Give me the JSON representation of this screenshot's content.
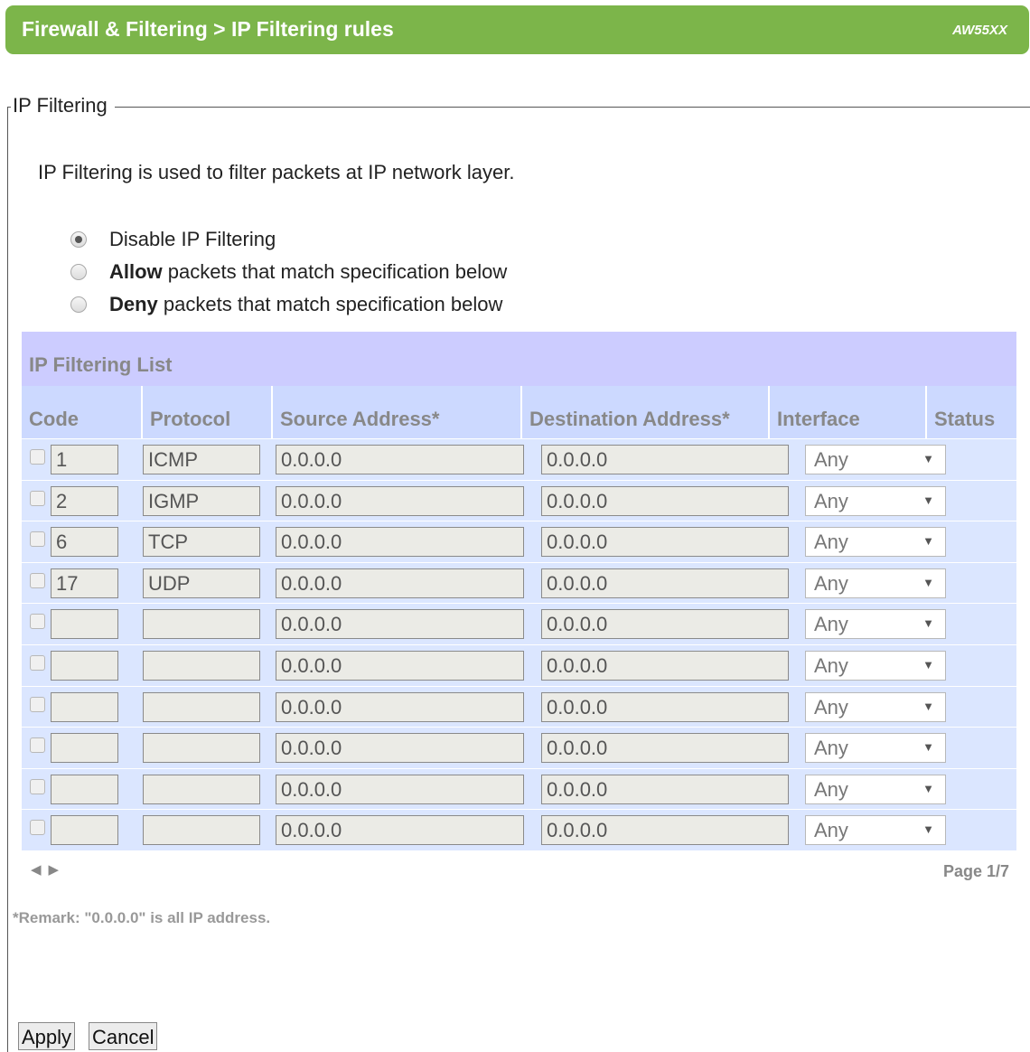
{
  "header": {
    "title": "Firewall & Filtering > IP Filtering rules",
    "model": "AW55XX"
  },
  "fieldset": {
    "legend": "IP Filtering",
    "description": "IP Filtering is used to filter packets at IP network layer."
  },
  "mode_options": [
    {
      "bold": "",
      "text": "Disable IP Filtering",
      "checked": true
    },
    {
      "bold": "Allow",
      "text": " packets that match specification below",
      "checked": false
    },
    {
      "bold": "Deny",
      "text": " packets that match specification below",
      "checked": false
    }
  ],
  "list": {
    "title": "IP Filtering List",
    "columns": [
      "Code",
      "Protocol",
      "Source Address*",
      "Destination Address*",
      "Interface",
      "Status"
    ],
    "rows": [
      {
        "code": "1",
        "protocol": "ICMP",
        "source": "0.0.0.0",
        "destination": "0.0.0.0",
        "interface": "Any"
      },
      {
        "code": "2",
        "protocol": "IGMP",
        "source": "0.0.0.0",
        "destination": "0.0.0.0",
        "interface": "Any"
      },
      {
        "code": "6",
        "protocol": "TCP",
        "source": "0.0.0.0",
        "destination": "0.0.0.0",
        "interface": "Any"
      },
      {
        "code": "17",
        "protocol": "UDP",
        "source": "0.0.0.0",
        "destination": "0.0.0.0",
        "interface": "Any"
      },
      {
        "code": "",
        "protocol": "",
        "source": "0.0.0.0",
        "destination": "0.0.0.0",
        "interface": "Any"
      },
      {
        "code": "",
        "protocol": "",
        "source": "0.0.0.0",
        "destination": "0.0.0.0",
        "interface": "Any"
      },
      {
        "code": "",
        "protocol": "",
        "source": "0.0.0.0",
        "destination": "0.0.0.0",
        "interface": "Any"
      },
      {
        "code": "",
        "protocol": "",
        "source": "0.0.0.0",
        "destination": "0.0.0.0",
        "interface": "Any"
      },
      {
        "code": "",
        "protocol": "",
        "source": "0.0.0.0",
        "destination": "0.0.0.0",
        "interface": "Any"
      },
      {
        "code": "",
        "protocol": "",
        "source": "0.0.0.0",
        "destination": "0.0.0.0",
        "interface": "Any"
      }
    ],
    "pager": {
      "prev_icon": "triangle-left-icon",
      "next_icon": "triangle-right-icon",
      "page_label": "Page 1/7"
    }
  },
  "remark": "*Remark: \"0.0.0.0\" is all IP address.",
  "buttons": {
    "apply": "Apply",
    "cancel": "Cancel"
  }
}
